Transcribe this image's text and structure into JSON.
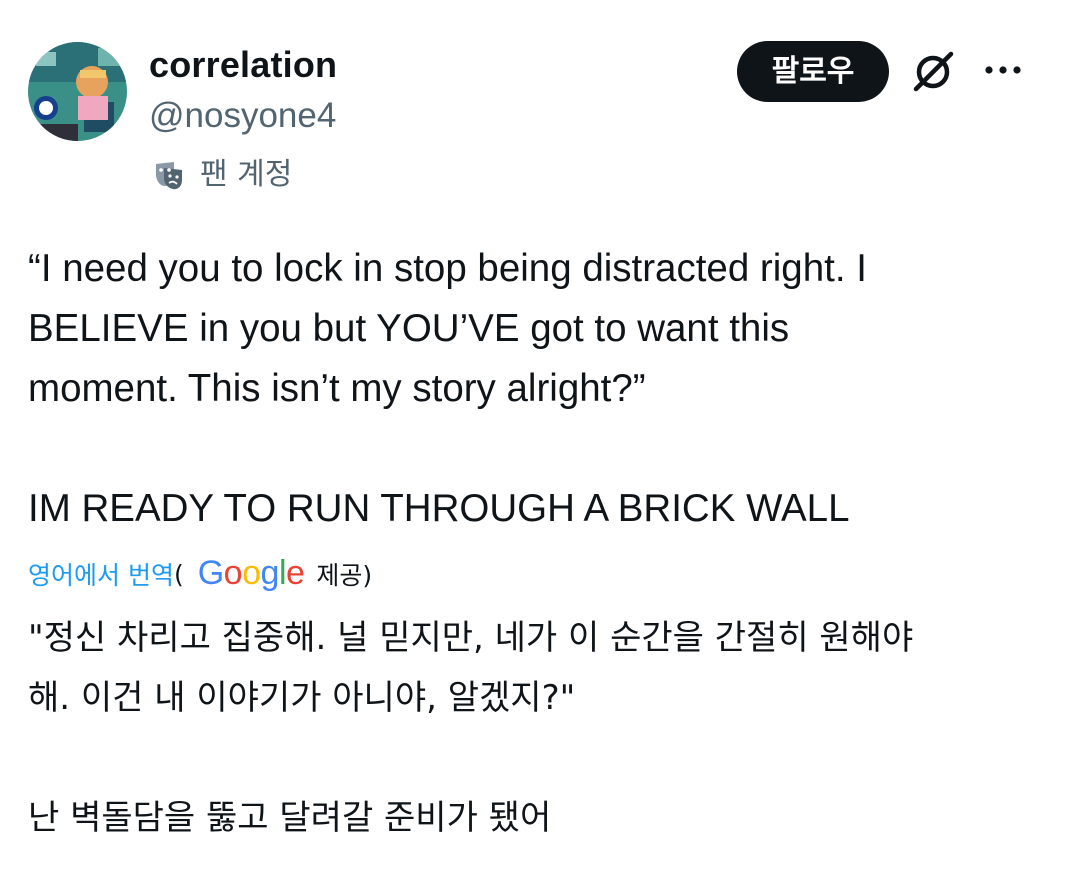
{
  "author": {
    "display_name": "correlation",
    "handle": "@nosyone4",
    "account_label": "팬 계정"
  },
  "actions": {
    "follow_label": "팔로우",
    "grok_icon": "grok-slash-icon",
    "more_icon": "more-dots-icon"
  },
  "tweet": {
    "lines": [
      "“I need you to lock in stop being distracted right. I",
      "BELIEVE in you but YOU’VE got to want this",
      "moment. This isn’t my story alright?”",
      "IM READY TO RUN THROUGH A BRICK WALL"
    ]
  },
  "translation": {
    "link_label": "영어에서 번역",
    "open_paren": "(",
    "google_letters": [
      "G",
      "o",
      "o",
      "g",
      "l",
      "e"
    ],
    "provided_label": "제공)",
    "lines": [
      "\"정신 차리고 집중해. 널 믿지만, 네가 이 순간을 간절히 원해야",
      "해. 이건 내 이야기가 아니야, 알겠지?\"",
      "난 벽돌담을 뚫고 달려갈 준비가 됐어"
    ]
  },
  "colors": {
    "text_primary": "#0f1419",
    "text_secondary": "#536471",
    "link_blue": "#1d9bf0",
    "follow_bg": "#0f1419",
    "google_blue": "#4285f4",
    "google_red": "#ea4335",
    "google_yellow": "#fbbc05",
    "google_green": "#34a853"
  }
}
